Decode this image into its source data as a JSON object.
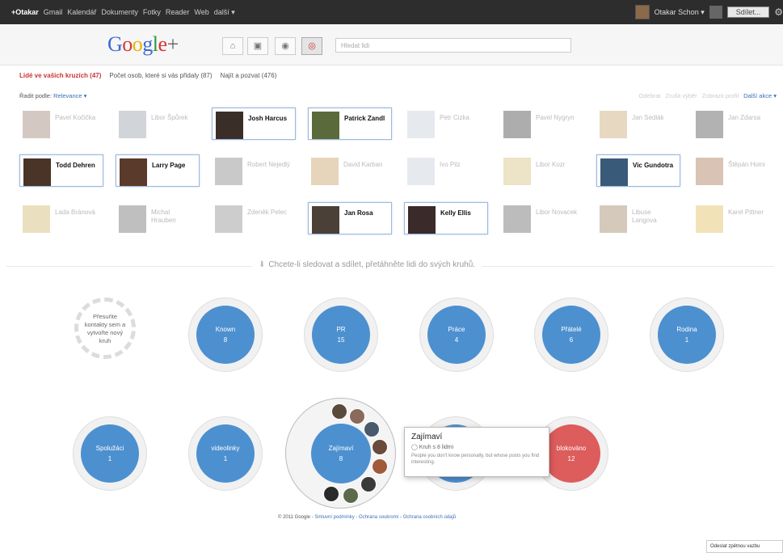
{
  "gbar": {
    "links": [
      "+Otakar",
      "Gmail",
      "Kalendář",
      "Dokumenty",
      "Fotky",
      "Reader",
      "Web",
      "další ▾"
    ],
    "user_name": "Otakar Schon ▾",
    "share_label": "Sdílet..."
  },
  "header": {
    "logo": "Google+",
    "search_placeholder": "Hledat lidi"
  },
  "tabs": [
    "Lidé ve vašich kruzích (47)",
    "Počet osob, které si vás přidaly (87)",
    "Najít a pozvat (476)"
  ],
  "sort": {
    "label": "Řadit podle:",
    "value": "Relevance ▾"
  },
  "actions": [
    "Odebrat",
    "Zrušit výběr",
    "Zobrazit profil",
    "Další akce ▾"
  ],
  "people": [
    {
      "name": "Pavel Kočička",
      "selected": false,
      "color": "#a08878"
    },
    {
      "name": "Libor Špůrek",
      "selected": false,
      "color": "#9aa0a8"
    },
    {
      "name": "Josh Harcus",
      "selected": true,
      "color": "#3a2f28"
    },
    {
      "name": "Patrick Zandl",
      "selected": true,
      "color": "#5a6a3a"
    },
    {
      "name": "Petr Cizka",
      "selected": false,
      "color": "#c8d0dc"
    },
    {
      "name": "Pavel Nygryn",
      "selected": false,
      "color": "#4a4a4a"
    },
    {
      "name": "Jan Sedlák",
      "selected": false,
      "color": "#c9a878"
    },
    {
      "name": "Jan Zdarsa",
      "selected": false,
      "color": "#555"
    },
    {
      "name": "Todd Dehren",
      "selected": true,
      "color": "#4a3428"
    },
    {
      "name": "Larry Page",
      "selected": true,
      "color": "#5a3a2a"
    },
    {
      "name": "Robert Nejedlý",
      "selected": false,
      "color": "#888"
    },
    {
      "name": "David Karban",
      "selected": false,
      "color": "#c8a068"
    },
    {
      "name": "Ivo Pilz",
      "selected": false,
      "color": "#c8d0dc"
    },
    {
      "name": "Libor Kozr",
      "selected": false,
      "color": "#d8c080"
    },
    {
      "name": "Vic Gundotra",
      "selected": true,
      "color": "#3a5a7a"
    },
    {
      "name": "Štěpán Hoini",
      "selected": false,
      "color": "#a87a58"
    },
    {
      "name": "Lada Bránová",
      "selected": false,
      "color": "#d0b870"
    },
    {
      "name": "Michal Hrauben",
      "selected": false,
      "color": "#707070"
    },
    {
      "name": "Zdeněk Pelec",
      "selected": false,
      "color": "#909090"
    },
    {
      "name": "Jan Rosa",
      "selected": true,
      "color": "#4a4038"
    },
    {
      "name": "Kelly Ellis",
      "selected": true,
      "color": "#3a2a2a"
    },
    {
      "name": "Libor Novacek",
      "selected": false,
      "color": "#6a6a6a"
    },
    {
      "name": "Libuse Langova",
      "selected": false,
      "color": "#a08868"
    },
    {
      "name": "Karel Pittner",
      "selected": false,
      "color": "#e0c060"
    }
  ],
  "instruction": "Chcete-li sledovat a sdílet, přetáhněte lidi do svých kruhů.",
  "new_circle": "Přesuňte kontakty sem a vytvořte nový kruh",
  "circles": [
    {
      "name": "Known",
      "count": "8"
    },
    {
      "name": "PR",
      "count": "15"
    },
    {
      "name": "Práce",
      "count": "4"
    },
    {
      "name": "Přátelé",
      "count": "6"
    },
    {
      "name": "Rodina",
      "count": "1"
    },
    {
      "name": "Spolužáci",
      "count": "1"
    },
    {
      "name": "videolinky",
      "count": "1"
    },
    {
      "name": "Zajímaví",
      "count": "8"
    },
    {
      "name": "blokováno",
      "count": "12"
    }
  ],
  "tooltip": {
    "title": "Zajímaví",
    "meta": "Kruh s 8 lidmi",
    "desc": "People you don't know personally, but whose posts you find interesting."
  },
  "footer": {
    "copyright": "© 2011 Google - ",
    "links": [
      "Smluvní podmínky",
      "Ochrana soukromí",
      "Ochrana osobních údajů"
    ]
  },
  "feedback": "Odeslat zpětnou vazbu"
}
